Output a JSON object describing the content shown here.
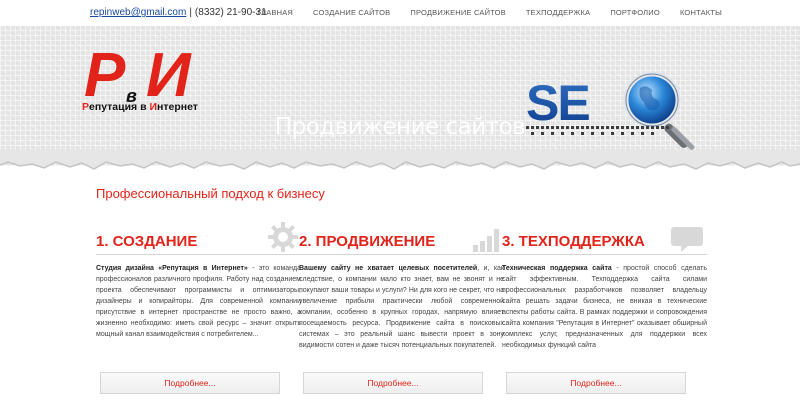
{
  "topbar": {
    "email": "repinweb@gmail.com",
    "separator": "|",
    "phone": "(8332) 21-90-31",
    "nav": [
      "ГЛАВНАЯ",
      "СОЗДАНИЕ САЙТОВ",
      "ПРОДВИЖЕНИЕ САЙТОВ",
      "ТЕХПОДДЕРЖКА",
      "ПОРТФОЛИО",
      "КОНТАКТЫ"
    ]
  },
  "logo": {
    "letters": "РвИ",
    "letter_r": "Р",
    "letter_v": "в",
    "letter_i": "И",
    "tagline_r": "Р",
    "tagline_1": "епутация в ",
    "tagline_i": "И",
    "tagline_2": "нтернет"
  },
  "hero": {
    "title": "Продвижение сайтов",
    "seo_text": "SEO"
  },
  "subtitle": "Профессиональный подход к бизнесу",
  "columns": [
    {
      "title": "1. СОЗДАНИЕ",
      "icon": "gear-icon",
      "lead": "Студия дизайна «Репутация в Интернет»",
      "body": " - это команда профессионалов различного профиля. Работу над созданием проекта обеспечивают программисты и оптимизаторы, дизайнеры и копирайторы. Для современной компании присутствие в интернет пространстве не просто важно, а жизненно необходимо: иметь свой ресурс – значит открыть мощный канал взаимодействия с потребителем..."
    },
    {
      "title": "2. ПРОДВИЖЕНИЕ",
      "icon": "bar-chart-icon",
      "lead": "Вашему сайту не хватает целевых посетителей",
      "body": ", и, как следствие, о компании мало кто знает, вам не звонят и не покупают ваши товары и услуги? Ни для кого не секрет, что на увеличение прибыли практически любой современной компании, особенно в крупных городах, напрямую влияет посещаемость ресурса. Продвижение сайта в поисковых системах – это реальный шанс вывести проект в зону видимости сотен и даже тысяч потенциальных покупателей."
    },
    {
      "title": "3. ТЕХПОДДЕРЖКА",
      "icon": "speech-bubble-icon",
      "lead": "Техническая поддержка сайта",
      "body": " - простой способ сделать сайт эффективным. Техподдержка сайта силами профессиональных разработчиков позволяет владельцу сайта решать задачи бизнеса, не вникая в технические аспекты работы сайта. В рамках поддержки и сопровождения сайта компания \"Репутация в Интернет\" оказывает обширный комплекс услуг, предназначенных для поддержки всех необходимых функций сайта"
    }
  ],
  "more_button": "Подробнее...",
  "colors": {
    "accent": "#e2231a",
    "seo_blue": "#1a4fa3"
  }
}
